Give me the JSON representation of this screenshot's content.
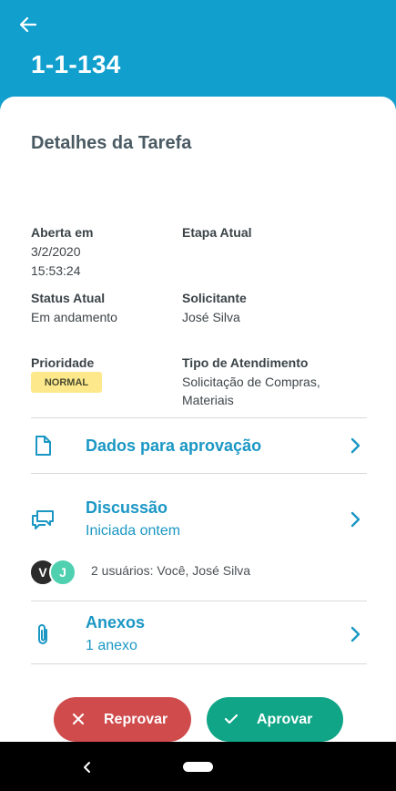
{
  "header": {
    "task_id": "1-1-134"
  },
  "details": {
    "title": "Detalhes da Tarefa",
    "opened_label": "Aberta em",
    "opened_date": "3/2/2020",
    "opened_time": "15:53:24",
    "stage_label": "Etapa Atual",
    "status_label": "Status Atual",
    "status_value": "Em andamento",
    "requester_label": "Solicitante",
    "requester_value": "José Silva",
    "priority_label": "Prioridade",
    "priority_value": "NORMAL",
    "service_type_label": "Tipo de Atendimento",
    "service_type_line1": "Solicitação de Compras,",
    "service_type_line2": "Materiais"
  },
  "rows": {
    "approval": {
      "title": "Dados para aprovação",
      "icon": "document-icon"
    },
    "discussion": {
      "title": "Discussão",
      "subtitle": "Iniciada ontem",
      "icon": "chat-icon",
      "avatars": [
        {
          "initial": "V",
          "color": "#2b2b2b"
        },
        {
          "initial": "J",
          "color": "#4fd1b0"
        }
      ],
      "users_text": "2 usuários:  Você, José Silva"
    },
    "attachments": {
      "title": "Anexos",
      "subtitle": "1 anexo",
      "icon": "paperclip-icon"
    }
  },
  "actions": {
    "reject_label": "Reprovar",
    "approve_label": "Aprovar"
  },
  "colors": {
    "primary": "#119fce",
    "link": "#1b97c4",
    "reject": "#cf4b4c",
    "approve": "#0fa586",
    "badge": "#fde98b"
  }
}
